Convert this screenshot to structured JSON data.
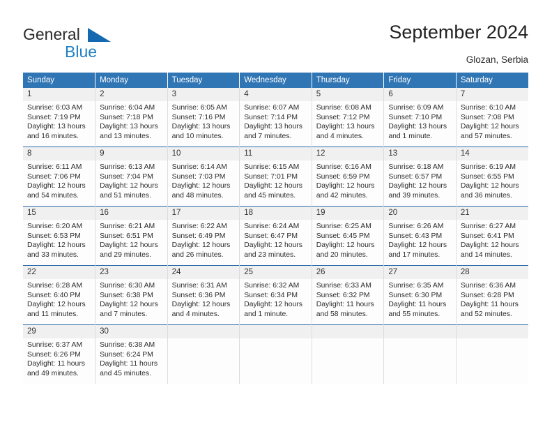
{
  "brand": {
    "name_dark": "General",
    "name_blue": "Blue",
    "accent_blue": "#1e7fc4",
    "triangle_blue": "#1569b0"
  },
  "header": {
    "title": "September 2024",
    "location": "Glozan, Serbia"
  },
  "theme": {
    "header_bg": "#3075b4",
    "header_text": "#ffffff",
    "daynum_bg": "#f0f0f0",
    "row_rule": "#2b6ca8"
  },
  "weekdays": [
    "Sunday",
    "Monday",
    "Tuesday",
    "Wednesday",
    "Thursday",
    "Friday",
    "Saturday"
  ],
  "weeks": [
    [
      {
        "day": "1",
        "sunrise": "Sunrise: 6:03 AM",
        "sunset": "Sunset: 7:19 PM",
        "daylight1": "Daylight: 13 hours",
        "daylight2": "and 16 minutes."
      },
      {
        "day": "2",
        "sunrise": "Sunrise: 6:04 AM",
        "sunset": "Sunset: 7:18 PM",
        "daylight1": "Daylight: 13 hours",
        "daylight2": "and 13 minutes."
      },
      {
        "day": "3",
        "sunrise": "Sunrise: 6:05 AM",
        "sunset": "Sunset: 7:16 PM",
        "daylight1": "Daylight: 13 hours",
        "daylight2": "and 10 minutes."
      },
      {
        "day": "4",
        "sunrise": "Sunrise: 6:07 AM",
        "sunset": "Sunset: 7:14 PM",
        "daylight1": "Daylight: 13 hours",
        "daylight2": "and 7 minutes."
      },
      {
        "day": "5",
        "sunrise": "Sunrise: 6:08 AM",
        "sunset": "Sunset: 7:12 PM",
        "daylight1": "Daylight: 13 hours",
        "daylight2": "and 4 minutes."
      },
      {
        "day": "6",
        "sunrise": "Sunrise: 6:09 AM",
        "sunset": "Sunset: 7:10 PM",
        "daylight1": "Daylight: 13 hours",
        "daylight2": "and 1 minute."
      },
      {
        "day": "7",
        "sunrise": "Sunrise: 6:10 AM",
        "sunset": "Sunset: 7:08 PM",
        "daylight1": "Daylight: 12 hours",
        "daylight2": "and 57 minutes."
      }
    ],
    [
      {
        "day": "8",
        "sunrise": "Sunrise: 6:11 AM",
        "sunset": "Sunset: 7:06 PM",
        "daylight1": "Daylight: 12 hours",
        "daylight2": "and 54 minutes."
      },
      {
        "day": "9",
        "sunrise": "Sunrise: 6:13 AM",
        "sunset": "Sunset: 7:04 PM",
        "daylight1": "Daylight: 12 hours",
        "daylight2": "and 51 minutes."
      },
      {
        "day": "10",
        "sunrise": "Sunrise: 6:14 AM",
        "sunset": "Sunset: 7:03 PM",
        "daylight1": "Daylight: 12 hours",
        "daylight2": "and 48 minutes."
      },
      {
        "day": "11",
        "sunrise": "Sunrise: 6:15 AM",
        "sunset": "Sunset: 7:01 PM",
        "daylight1": "Daylight: 12 hours",
        "daylight2": "and 45 minutes."
      },
      {
        "day": "12",
        "sunrise": "Sunrise: 6:16 AM",
        "sunset": "Sunset: 6:59 PM",
        "daylight1": "Daylight: 12 hours",
        "daylight2": "and 42 minutes."
      },
      {
        "day": "13",
        "sunrise": "Sunrise: 6:18 AM",
        "sunset": "Sunset: 6:57 PM",
        "daylight1": "Daylight: 12 hours",
        "daylight2": "and 39 minutes."
      },
      {
        "day": "14",
        "sunrise": "Sunrise: 6:19 AM",
        "sunset": "Sunset: 6:55 PM",
        "daylight1": "Daylight: 12 hours",
        "daylight2": "and 36 minutes."
      }
    ],
    [
      {
        "day": "15",
        "sunrise": "Sunrise: 6:20 AM",
        "sunset": "Sunset: 6:53 PM",
        "daylight1": "Daylight: 12 hours",
        "daylight2": "and 33 minutes."
      },
      {
        "day": "16",
        "sunrise": "Sunrise: 6:21 AM",
        "sunset": "Sunset: 6:51 PM",
        "daylight1": "Daylight: 12 hours",
        "daylight2": "and 29 minutes."
      },
      {
        "day": "17",
        "sunrise": "Sunrise: 6:22 AM",
        "sunset": "Sunset: 6:49 PM",
        "daylight1": "Daylight: 12 hours",
        "daylight2": "and 26 minutes."
      },
      {
        "day": "18",
        "sunrise": "Sunrise: 6:24 AM",
        "sunset": "Sunset: 6:47 PM",
        "daylight1": "Daylight: 12 hours",
        "daylight2": "and 23 minutes."
      },
      {
        "day": "19",
        "sunrise": "Sunrise: 6:25 AM",
        "sunset": "Sunset: 6:45 PM",
        "daylight1": "Daylight: 12 hours",
        "daylight2": "and 20 minutes."
      },
      {
        "day": "20",
        "sunrise": "Sunrise: 6:26 AM",
        "sunset": "Sunset: 6:43 PM",
        "daylight1": "Daylight: 12 hours",
        "daylight2": "and 17 minutes."
      },
      {
        "day": "21",
        "sunrise": "Sunrise: 6:27 AM",
        "sunset": "Sunset: 6:41 PM",
        "daylight1": "Daylight: 12 hours",
        "daylight2": "and 14 minutes."
      }
    ],
    [
      {
        "day": "22",
        "sunrise": "Sunrise: 6:28 AM",
        "sunset": "Sunset: 6:40 PM",
        "daylight1": "Daylight: 12 hours",
        "daylight2": "and 11 minutes."
      },
      {
        "day": "23",
        "sunrise": "Sunrise: 6:30 AM",
        "sunset": "Sunset: 6:38 PM",
        "daylight1": "Daylight: 12 hours",
        "daylight2": "and 7 minutes."
      },
      {
        "day": "24",
        "sunrise": "Sunrise: 6:31 AM",
        "sunset": "Sunset: 6:36 PM",
        "daylight1": "Daylight: 12 hours",
        "daylight2": "and 4 minutes."
      },
      {
        "day": "25",
        "sunrise": "Sunrise: 6:32 AM",
        "sunset": "Sunset: 6:34 PM",
        "daylight1": "Daylight: 12 hours",
        "daylight2": "and 1 minute."
      },
      {
        "day": "26",
        "sunrise": "Sunrise: 6:33 AM",
        "sunset": "Sunset: 6:32 PM",
        "daylight1": "Daylight: 11 hours",
        "daylight2": "and 58 minutes."
      },
      {
        "day": "27",
        "sunrise": "Sunrise: 6:35 AM",
        "sunset": "Sunset: 6:30 PM",
        "daylight1": "Daylight: 11 hours",
        "daylight2": "and 55 minutes."
      },
      {
        "day": "28",
        "sunrise": "Sunrise: 6:36 AM",
        "sunset": "Sunset: 6:28 PM",
        "daylight1": "Daylight: 11 hours",
        "daylight2": "and 52 minutes."
      }
    ],
    [
      {
        "day": "29",
        "sunrise": "Sunrise: 6:37 AM",
        "sunset": "Sunset: 6:26 PM",
        "daylight1": "Daylight: 11 hours",
        "daylight2": "and 49 minutes."
      },
      {
        "day": "30",
        "sunrise": "Sunrise: 6:38 AM",
        "sunset": "Sunset: 6:24 PM",
        "daylight1": "Daylight: 11 hours",
        "daylight2": "and 45 minutes."
      },
      {
        "day": "",
        "sunrise": "",
        "sunset": "",
        "daylight1": "",
        "daylight2": ""
      },
      {
        "day": "",
        "sunrise": "",
        "sunset": "",
        "daylight1": "",
        "daylight2": ""
      },
      {
        "day": "",
        "sunrise": "",
        "sunset": "",
        "daylight1": "",
        "daylight2": ""
      },
      {
        "day": "",
        "sunrise": "",
        "sunset": "",
        "daylight1": "",
        "daylight2": ""
      },
      {
        "day": "",
        "sunrise": "",
        "sunset": "",
        "daylight1": "",
        "daylight2": ""
      }
    ]
  ]
}
